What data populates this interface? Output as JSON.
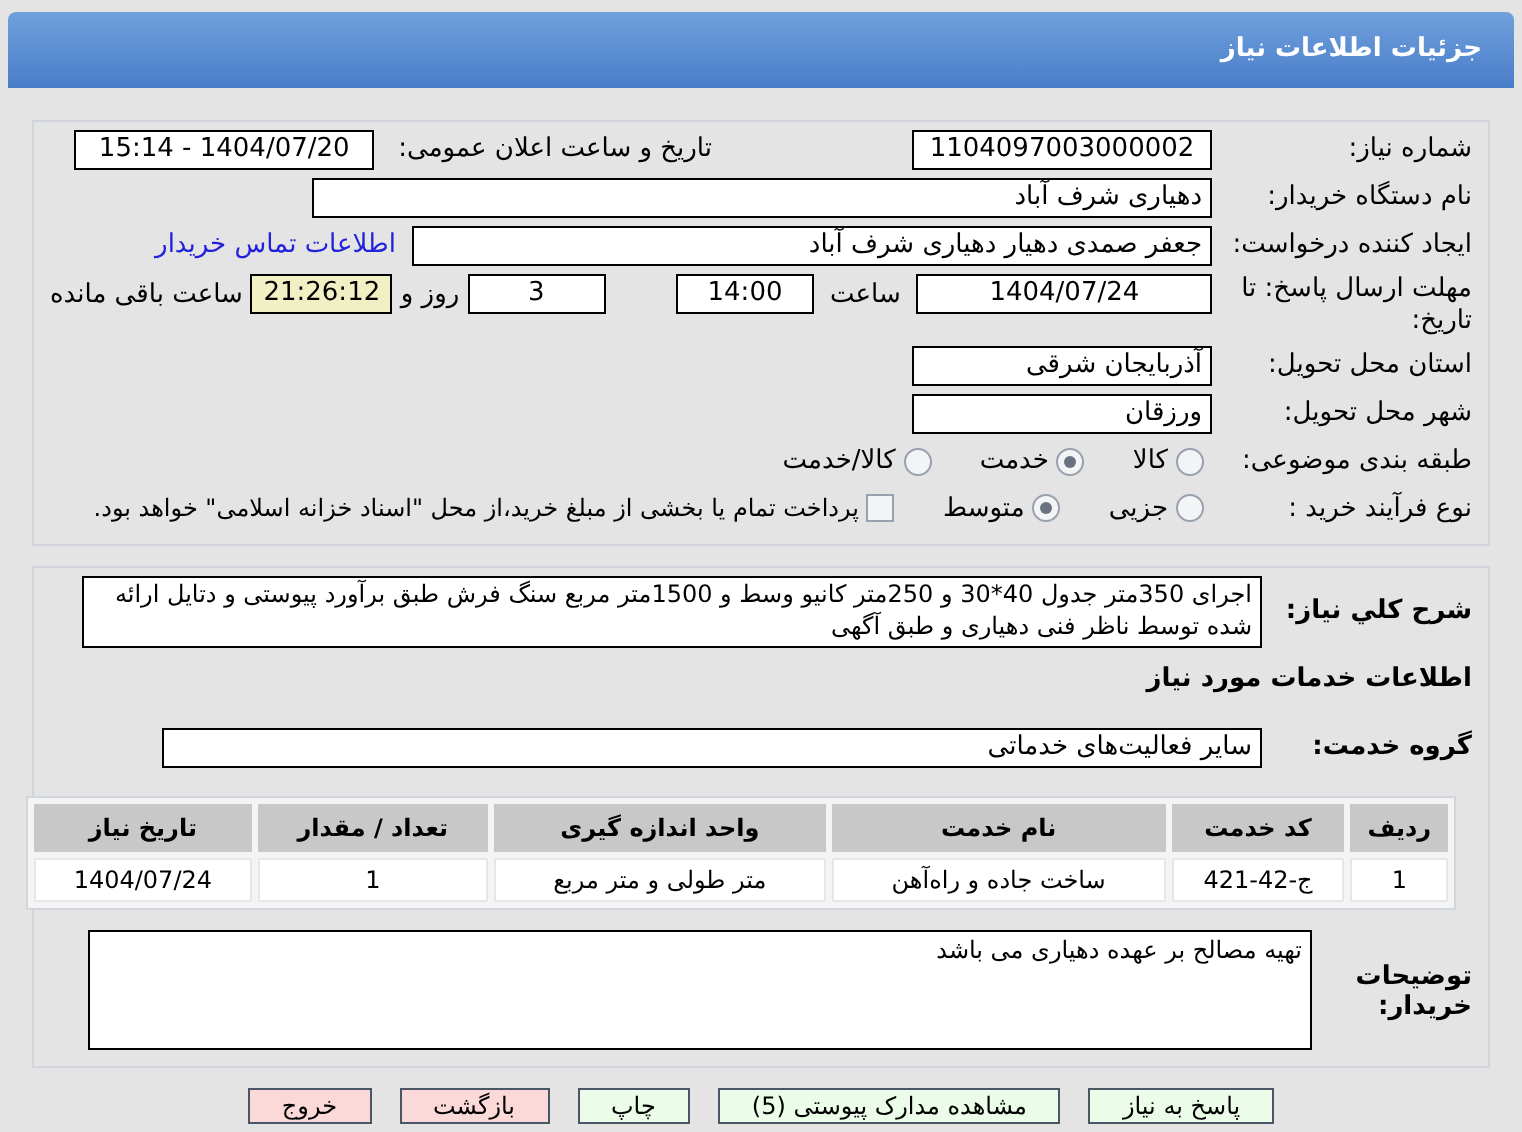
{
  "header": {
    "title": "جزئیات اطلاعات نیاز"
  },
  "fields": {
    "need_number": {
      "label": "شماره نیاز:",
      "value": "1104097003000002"
    },
    "announce": {
      "label": "تاریخ و ساعت اعلان عمومی:",
      "value": "1404/07/20 - 15:14"
    },
    "buyer": {
      "label": "نام دستگاه خریدار:",
      "value": "دهیاری شرف آباد"
    },
    "creator": {
      "label": "ایجاد کننده درخواست:",
      "value": "جعفر صمدی دهیار دهیاری شرف آباد",
      "link": "اطلاعات تماس خریدار"
    },
    "deadline": {
      "label": "مهلت ارسال پاسخ: تا تاریخ:",
      "date": "1404/07/24",
      "time_label": "ساعت",
      "time": "14:00",
      "days": "3",
      "days_label": "روز و",
      "remaining": "21:26:12",
      "remaining_label": "ساعت باقی مانده"
    },
    "province": {
      "label": "استان محل تحویل:",
      "value": "آذربایجان شرقی"
    },
    "city": {
      "label": "شهر محل تحویل:",
      "value": "ورزقان"
    }
  },
  "category": {
    "label": "طبقه بندی موضوعی:",
    "options": [
      {
        "label": "کالا",
        "selected": false
      },
      {
        "label": "خدمت",
        "selected": true
      },
      {
        "label": "کالا/خدمت",
        "selected": false
      }
    ]
  },
  "purchase_type": {
    "label": "نوع فرآیند خرید :",
    "options": [
      {
        "label": "جزیی",
        "selected": false
      },
      {
        "label": "متوسط",
        "selected": true
      }
    ],
    "payment": {
      "label": "پرداخت تمام یا بخشی از مبلغ خرید،از محل \"اسناد خزانه اسلامی\" خواهد بود.",
      "checked": false
    }
  },
  "description": {
    "label": "شرح کلي نياز:",
    "value": "اجرای 350متر جدول 40*30 و 250متر کانیو وسط و 1500متر مربع سنگ فرش طبق برآورد پیوستی و دتایل ارائه شده توسط ناظر فنی دهیاری و طبق آگهی"
  },
  "services_title": "اطلاعات خدمات مورد نیاز",
  "service_group": {
    "label": "گروه خدمت:",
    "value": "سایر فعالیت‌های خدماتی"
  },
  "table": {
    "columns": [
      "ردیف",
      "کد خدمت",
      "نام خدمت",
      "واحد اندازه گیری",
      "تعداد / مقدار",
      "تاریخ نیاز"
    ],
    "rows": [
      [
        "1",
        "ج-42-421",
        "ساخت جاده و راه‌آهن",
        "متر طولی و متر مربع",
        "1",
        "1404/07/24"
      ]
    ]
  },
  "notes": {
    "label": "توضیحات خریدار:",
    "value": "تهیه مصالح بر عهده دهیاری می باشد"
  },
  "buttons": [
    {
      "label": "پاسخ به نیاز",
      "kind": "primary"
    },
    {
      "label": "مشاهده مدارک پیوستی (5)",
      "kind": "primary"
    },
    {
      "label": "چاپ",
      "kind": "primary"
    },
    {
      "label": "بازگشت",
      "kind": "danger"
    },
    {
      "label": "خروج",
      "kind": "danger"
    }
  ]
}
